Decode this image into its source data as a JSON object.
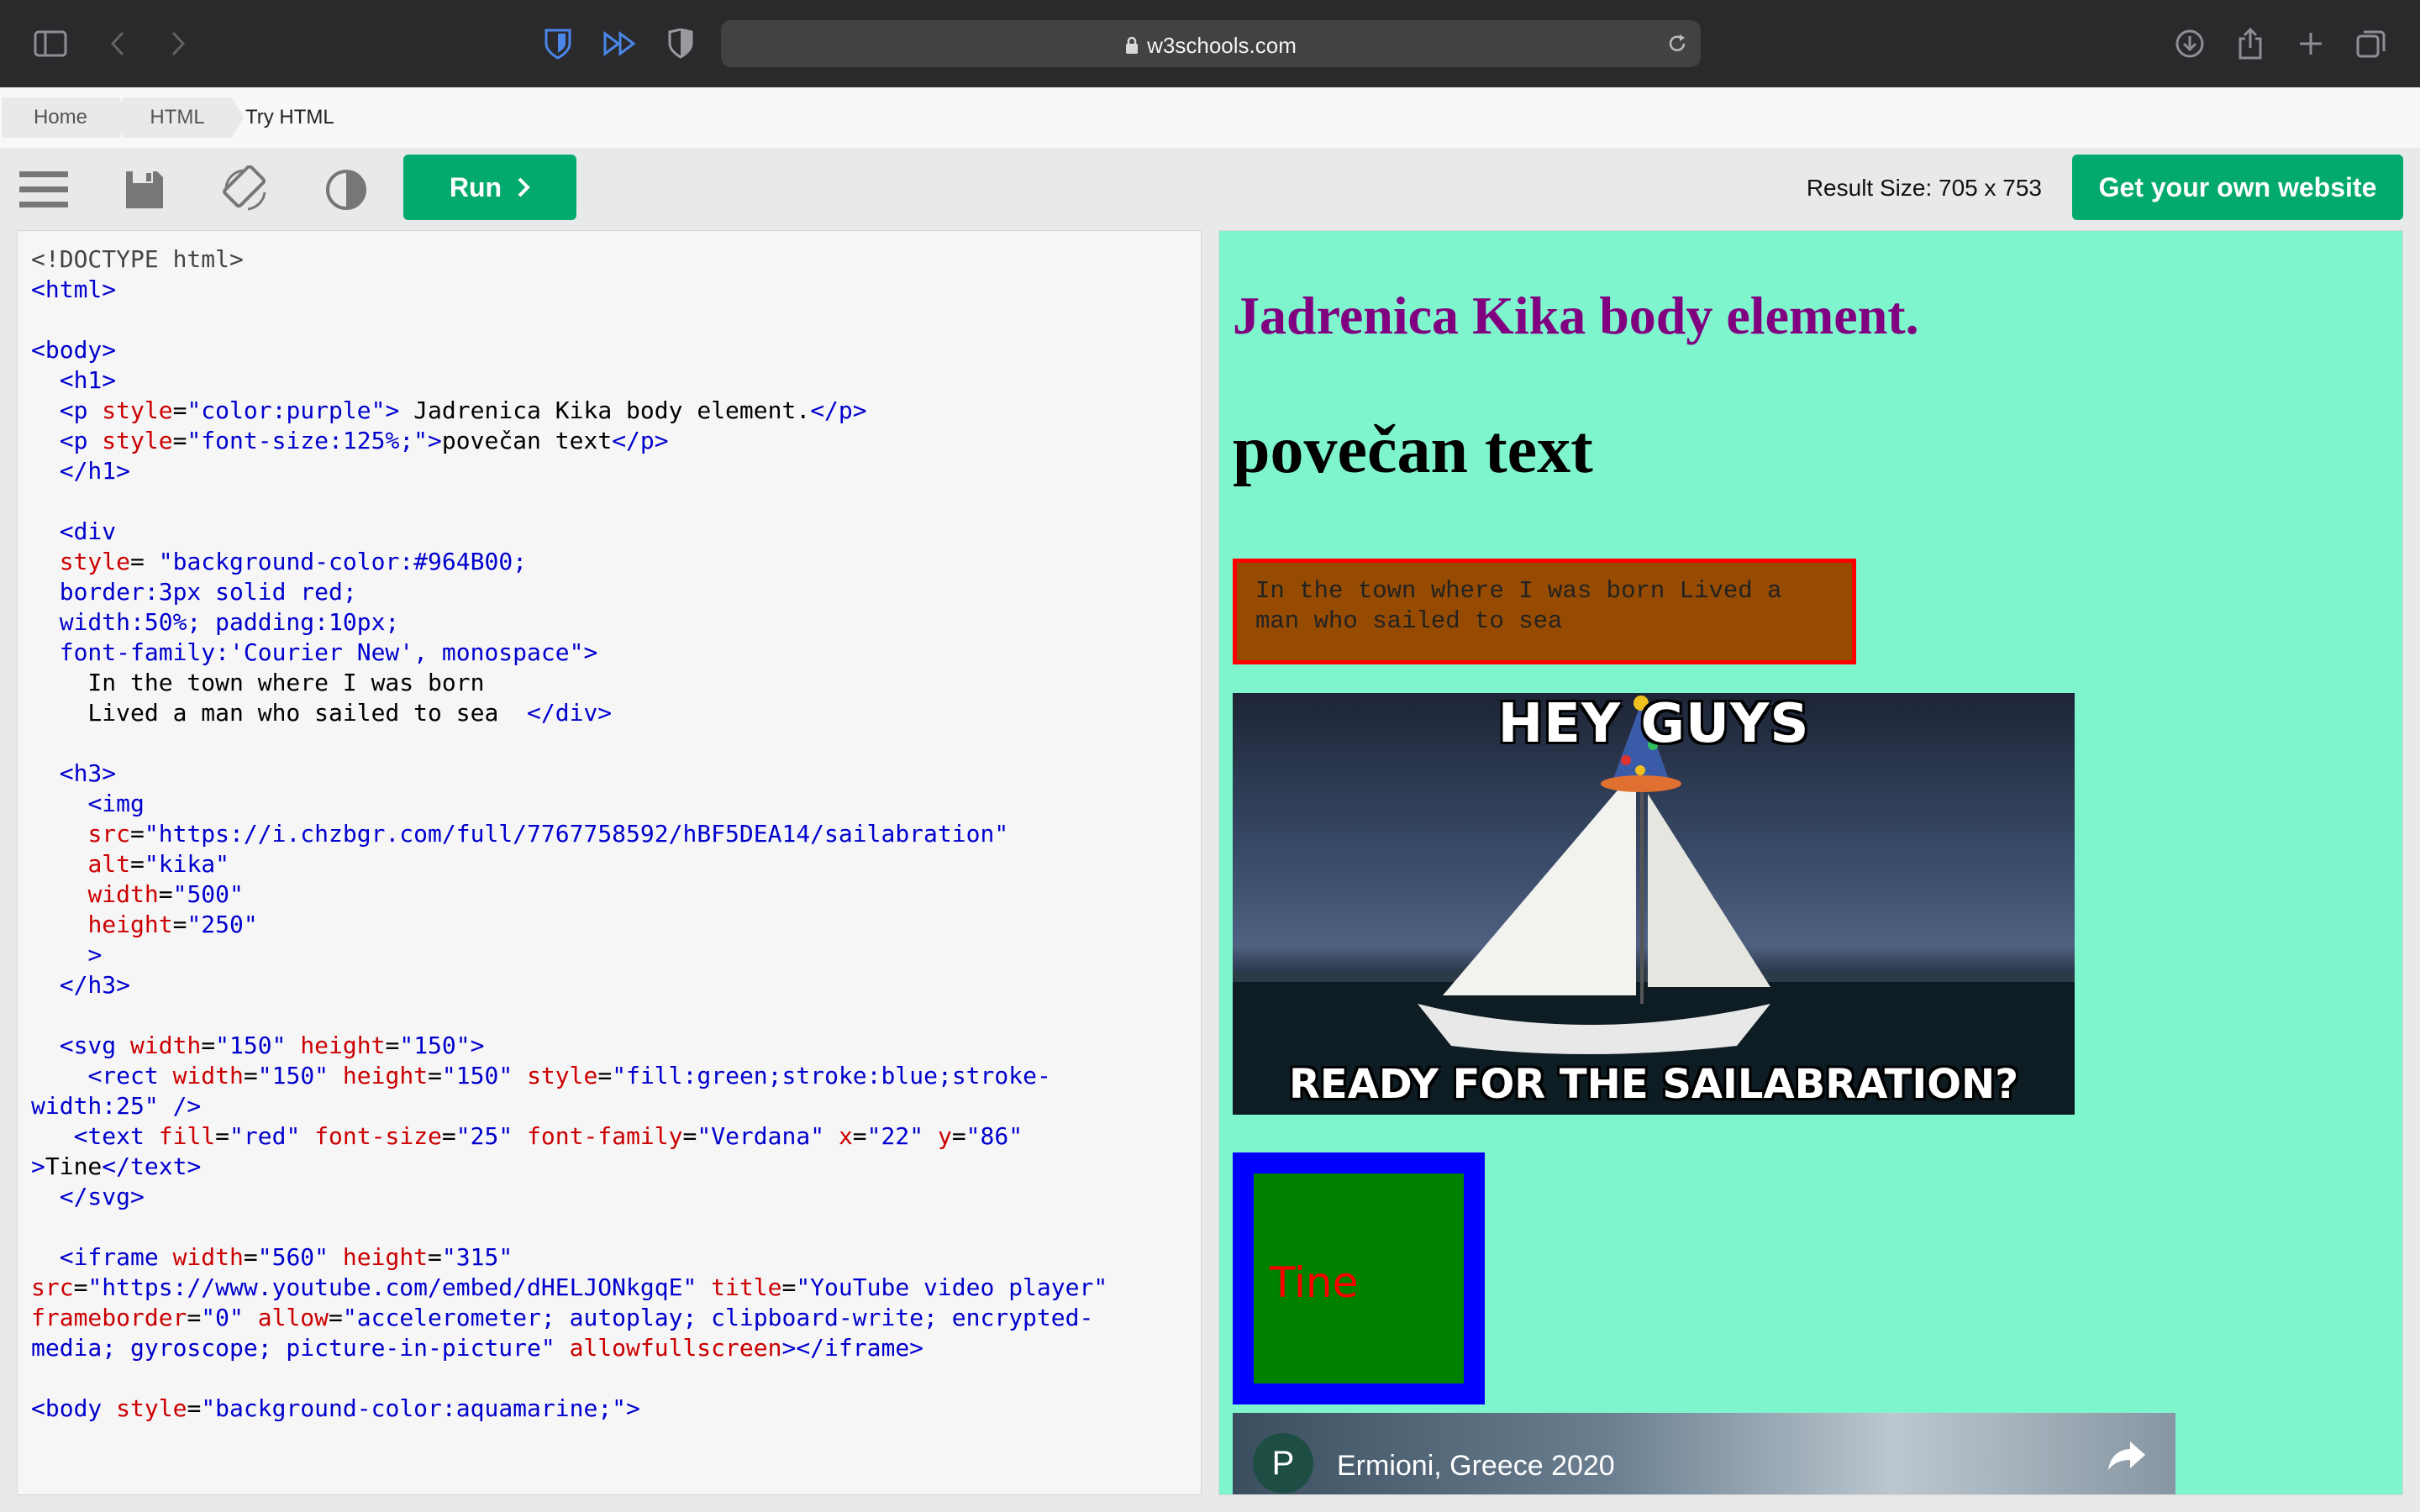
{
  "browser": {
    "url": "w3schools.com"
  },
  "breadcrumb": {
    "items": [
      "Home",
      "HTML",
      "Try HTML"
    ]
  },
  "toolbar": {
    "run_label": "Run",
    "result_size": "Result Size: 705 x 753",
    "get_site_label": "Get your own website"
  },
  "editor": {
    "code": [
      [
        [
          "doc",
          "<!DOCTYPE html>"
        ]
      ],
      [
        [
          "tag",
          "<html>"
        ]
      ],
      [],
      [
        [
          "tag",
          "<body>"
        ]
      ],
      [
        [
          "txt",
          "  "
        ],
        [
          "tag",
          "<h1>"
        ]
      ],
      [
        [
          "txt",
          "  "
        ],
        [
          "tag",
          "<p "
        ],
        [
          "attr",
          "style"
        ],
        [
          "txt",
          "="
        ],
        [
          "val",
          "\"color:purple\""
        ],
        [
          "tag",
          ">"
        ],
        [
          "txt",
          " Jadrenica Kika body element."
        ],
        [
          "tag",
          "</p>"
        ]
      ],
      [
        [
          "txt",
          "  "
        ],
        [
          "tag",
          "<p "
        ],
        [
          "attr",
          "style"
        ],
        [
          "txt",
          "="
        ],
        [
          "val",
          "\"font-size:125%;\""
        ],
        [
          "tag",
          ">"
        ],
        [
          "txt",
          "povečan text"
        ],
        [
          "tag",
          "</p>"
        ]
      ],
      [
        [
          "txt",
          "  "
        ],
        [
          "tag",
          "</h1>"
        ]
      ],
      [],
      [
        [
          "txt",
          "  "
        ],
        [
          "tag",
          "<div"
        ]
      ],
      [
        [
          "txt",
          "  "
        ],
        [
          "attr",
          "style"
        ],
        [
          "txt",
          "= "
        ],
        [
          "val",
          "\"background-color:#964B00;"
        ]
      ],
      [
        [
          "val",
          "  border:3px solid red;"
        ]
      ],
      [
        [
          "val",
          "  width:50%; padding:10px;"
        ]
      ],
      [
        [
          "val",
          "  font-family:'Courier New', monospace\""
        ],
        [
          "tag",
          ">"
        ]
      ],
      [
        [
          "txt",
          "    In the town where I was born"
        ]
      ],
      [
        [
          "txt",
          "    Lived a man who sailed to sea  "
        ],
        [
          "tag",
          "</div>"
        ]
      ],
      [],
      [
        [
          "txt",
          "  "
        ],
        [
          "tag",
          "<h3>"
        ]
      ],
      [
        [
          "txt",
          "    "
        ],
        [
          "tag",
          "<img"
        ]
      ],
      [
        [
          "txt",
          "    "
        ],
        [
          "attr",
          "src"
        ],
        [
          "txt",
          "="
        ],
        [
          "val",
          "\"https://i.chzbgr.com/full/7767758592/hBF5DEA14/sailabration\""
        ]
      ],
      [
        [
          "txt",
          "    "
        ],
        [
          "attr",
          "alt"
        ],
        [
          "txt",
          "="
        ],
        [
          "val",
          "\"kika\""
        ]
      ],
      [
        [
          "txt",
          "    "
        ],
        [
          "attr",
          "width"
        ],
        [
          "txt",
          "="
        ],
        [
          "val",
          "\"500\""
        ]
      ],
      [
        [
          "txt",
          "    "
        ],
        [
          "attr",
          "height"
        ],
        [
          "txt",
          "="
        ],
        [
          "val",
          "\"250\""
        ]
      ],
      [
        [
          "txt",
          "    "
        ],
        [
          "tag",
          ">"
        ]
      ],
      [
        [
          "txt",
          "  "
        ],
        [
          "tag",
          "</h3>"
        ]
      ],
      [],
      [
        [
          "txt",
          "  "
        ],
        [
          "tag",
          "<svg "
        ],
        [
          "attr",
          "width"
        ],
        [
          "txt",
          "="
        ],
        [
          "val",
          "\"150\""
        ],
        [
          "txt",
          " "
        ],
        [
          "attr",
          "height"
        ],
        [
          "txt",
          "="
        ],
        [
          "val",
          "\"150\""
        ],
        [
          "tag",
          ">"
        ]
      ],
      [
        [
          "txt",
          "    "
        ],
        [
          "tag",
          "<rect "
        ],
        [
          "attr",
          "width"
        ],
        [
          "txt",
          "="
        ],
        [
          "val",
          "\"150\""
        ],
        [
          "txt",
          " "
        ],
        [
          "attr",
          "height"
        ],
        [
          "txt",
          "="
        ],
        [
          "val",
          "\"150\""
        ],
        [
          "txt",
          " "
        ],
        [
          "attr",
          "style"
        ],
        [
          "txt",
          "="
        ],
        [
          "val",
          "\"fill:green;stroke:blue;stroke-"
        ]
      ],
      [
        [
          "val",
          "width:25\""
        ],
        [
          "txt",
          " "
        ],
        [
          "tag",
          "/>"
        ]
      ],
      [
        [
          "txt",
          "   "
        ],
        [
          "tag",
          "<text "
        ],
        [
          "attr",
          "fill"
        ],
        [
          "txt",
          "="
        ],
        [
          "val",
          "\"red\""
        ],
        [
          "txt",
          " "
        ],
        [
          "attr",
          "font-size"
        ],
        [
          "txt",
          "="
        ],
        [
          "val",
          "\"25\""
        ],
        [
          "txt",
          " "
        ],
        [
          "attr",
          "font-family"
        ],
        [
          "txt",
          "="
        ],
        [
          "val",
          "\"Verdana\""
        ],
        [
          "txt",
          " "
        ],
        [
          "attr",
          "x"
        ],
        [
          "txt",
          "="
        ],
        [
          "val",
          "\"22\""
        ],
        [
          "txt",
          " "
        ],
        [
          "attr",
          "y"
        ],
        [
          "txt",
          "="
        ],
        [
          "val",
          "\"86\""
        ]
      ],
      [
        [
          "tag",
          ">"
        ],
        [
          "txt",
          "Tine"
        ],
        [
          "tag",
          "</text>"
        ]
      ],
      [
        [
          "txt",
          "  "
        ],
        [
          "tag",
          "</svg>"
        ]
      ],
      [],
      [
        [
          "txt",
          "  "
        ],
        [
          "tag",
          "<iframe "
        ],
        [
          "attr",
          "width"
        ],
        [
          "txt",
          "="
        ],
        [
          "val",
          "\"560\""
        ],
        [
          "txt",
          " "
        ],
        [
          "attr",
          "height"
        ],
        [
          "txt",
          "="
        ],
        [
          "val",
          "\"315\""
        ]
      ],
      [
        [
          "attr",
          "src"
        ],
        [
          "txt",
          "="
        ],
        [
          "val",
          "\"https://www.youtube.com/embed/dHELJONkgqE\""
        ],
        [
          "txt",
          " "
        ],
        [
          "attr",
          "title"
        ],
        [
          "txt",
          "="
        ],
        [
          "val",
          "\"YouTube video player\""
        ]
      ],
      [
        [
          "attr",
          "frameborder"
        ],
        [
          "txt",
          "="
        ],
        [
          "val",
          "\"0\""
        ],
        [
          "txt",
          " "
        ],
        [
          "attr",
          "allow"
        ],
        [
          "txt",
          "="
        ],
        [
          "val",
          "\"accelerometer; autoplay; clipboard-write; encrypted-"
        ]
      ],
      [
        [
          "val",
          "media; gyroscope; picture-in-picture\""
        ],
        [
          "txt",
          " "
        ],
        [
          "attr",
          "allowfullscreen"
        ],
        [
          "tag",
          "></iframe>"
        ]
      ],
      [],
      [
        [
          "tag",
          "<body "
        ],
        [
          "attr",
          "style"
        ],
        [
          "txt",
          "="
        ],
        [
          "val",
          "\"background-color:aquamarine;\""
        ],
        [
          "tag",
          ">"
        ]
      ]
    ]
  },
  "result": {
    "heading": "Jadrenica Kika body element.",
    "big_text": "povečan text",
    "box_text": "In the town where I was born Lived a man who sailed to sea",
    "meme_top": "HEY GUYS",
    "meme_bottom": "READY FOR THE SAILABRATION?",
    "svg_text": "Tine",
    "video_avatar": "P",
    "video_title": "Ermioni, Greece 2020"
  }
}
